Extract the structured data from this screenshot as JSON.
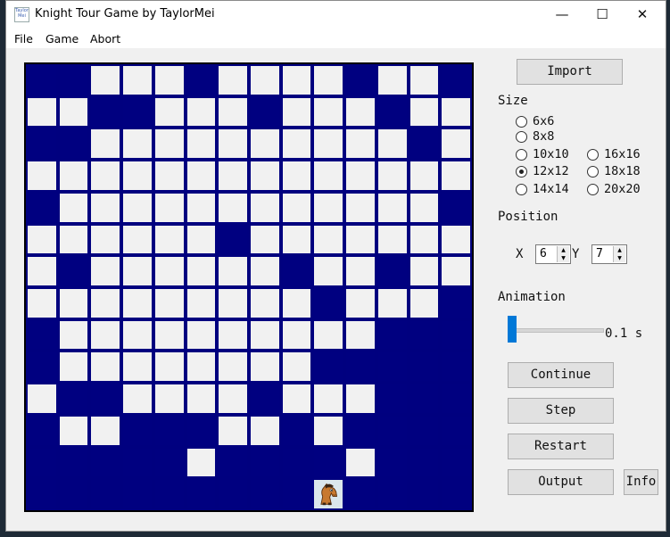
{
  "window": {
    "title": "Knight Tour Game by TaylorMei",
    "icon_text": "Taylor Mei",
    "controls": {
      "minimize": "—",
      "maximize": "☐",
      "close": "✕"
    }
  },
  "menu": [
    "File",
    "Game",
    "Abort"
  ],
  "board": {
    "size": 14,
    "knight": {
      "row": 13,
      "col": 9
    },
    "grid": [
      "11000100001001",
      "00110001000100",
      "11000000000010",
      "00000000000000",
      "10000000000001",
      "00000010000000",
      "01000000100100",
      "00000000010001",
      "10000000000111",
      "10000000011111",
      "01100001000111",
      "10011100101111",
      "11111011110111",
      "11111111111111"
    ]
  },
  "controls": {
    "import_label": "Import",
    "size_label": "Size",
    "size_options": [
      "6x6",
      "8x8",
      "10x10",
      "12x12",
      "14x14",
      "16x16",
      "18x18",
      "20x20"
    ],
    "size_selected": "12x12",
    "position_label": "Position",
    "x_label": "X",
    "x_value": "6",
    "y_label": "Y",
    "y_value": "7",
    "animation_label": "Animation",
    "animation_value": "0.1 s",
    "animation_level": 0.0,
    "continue_label": "Continue",
    "step_label": "Step",
    "restart_label": "Restart",
    "output_label": "Output",
    "info_label": "Info"
  },
  "colors": {
    "filled": "#000080",
    "empty": "#f1f1f1",
    "grid": "#00007f",
    "slider": "#0078d7"
  }
}
